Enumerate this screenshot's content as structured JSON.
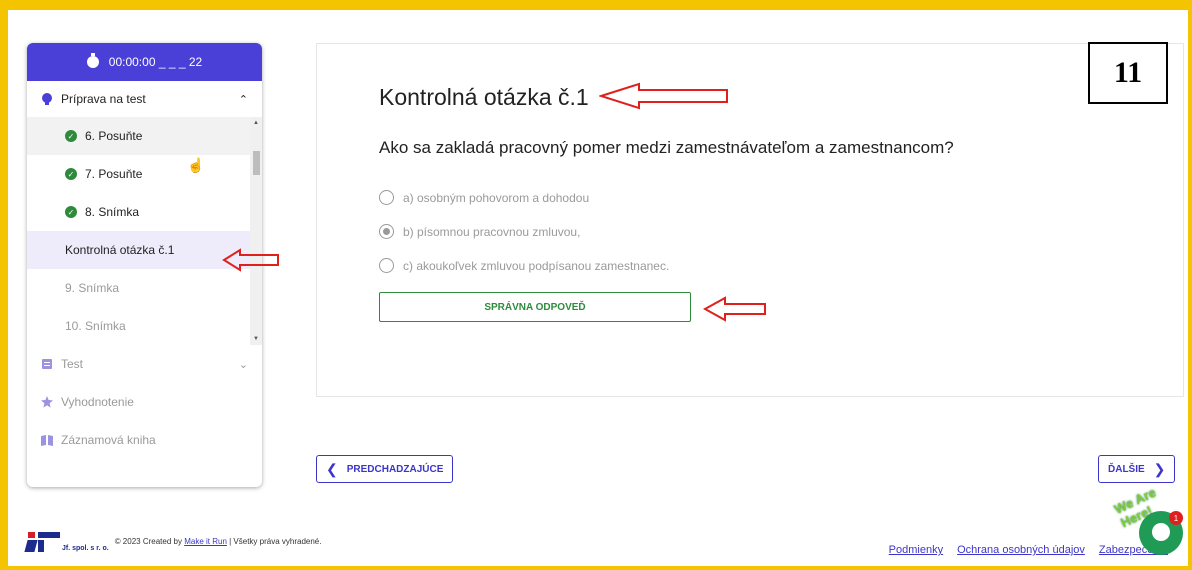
{
  "timer": {
    "value": "00:00:00 _ _ _ 22"
  },
  "sidebar": {
    "section_prep": {
      "label": "Príprava na test",
      "chevron": "^"
    },
    "items": [
      {
        "label": "6. Posuňte",
        "done": true
      },
      {
        "label": "7. Posuňte",
        "done": true
      },
      {
        "label": "8. Snímka",
        "done": true
      },
      {
        "label": "Kontrolná otázka č.1",
        "done": false
      },
      {
        "label": "9. Snímka",
        "done": false
      },
      {
        "label": "10. Snímka",
        "done": false
      }
    ],
    "section_test": {
      "label": "Test"
    },
    "section_eval": {
      "label": "Vyhodnotenie"
    },
    "section_log": {
      "label": "Záznamová kniha"
    }
  },
  "question": {
    "title": "Kontrolná otázka č.1",
    "text": "Ako sa zakladá pracovný pomer medzi zamestnávateľom a zamestnancom?",
    "options": [
      {
        "label": "a) osobným pohovorom a dohodou",
        "selected": false
      },
      {
        "label": "b) písomnou pracovnou zmluvou,",
        "selected": true
      },
      {
        "label": "c) akoukoľvek zmluvou podpísanou zamestnanec.",
        "selected": false
      }
    ],
    "answer_button": "SPRÁVNA ODPOVEĎ"
  },
  "badge": {
    "number": "11"
  },
  "nav": {
    "prev": "PREDCHADZAJÚCE",
    "next": "ĎALŠIE"
  },
  "footer": {
    "brand": "Jf. spol. s r. o.",
    "copyright_prefix": "© 2023 Created by",
    "link": "Make it Run",
    "copyright_suffix": "| Všetky práva vyhradené.",
    "links": [
      "Podmienky",
      "Ochrana osobných údajov",
      "Zabezpečenie"
    ]
  },
  "chat": {
    "label": "We Are Here!",
    "notifications": "1"
  },
  "colors": {
    "accent": "#4a3fd6",
    "success": "#2e8b3c",
    "frame": "#f5c400",
    "annotation": "#e0201c"
  }
}
